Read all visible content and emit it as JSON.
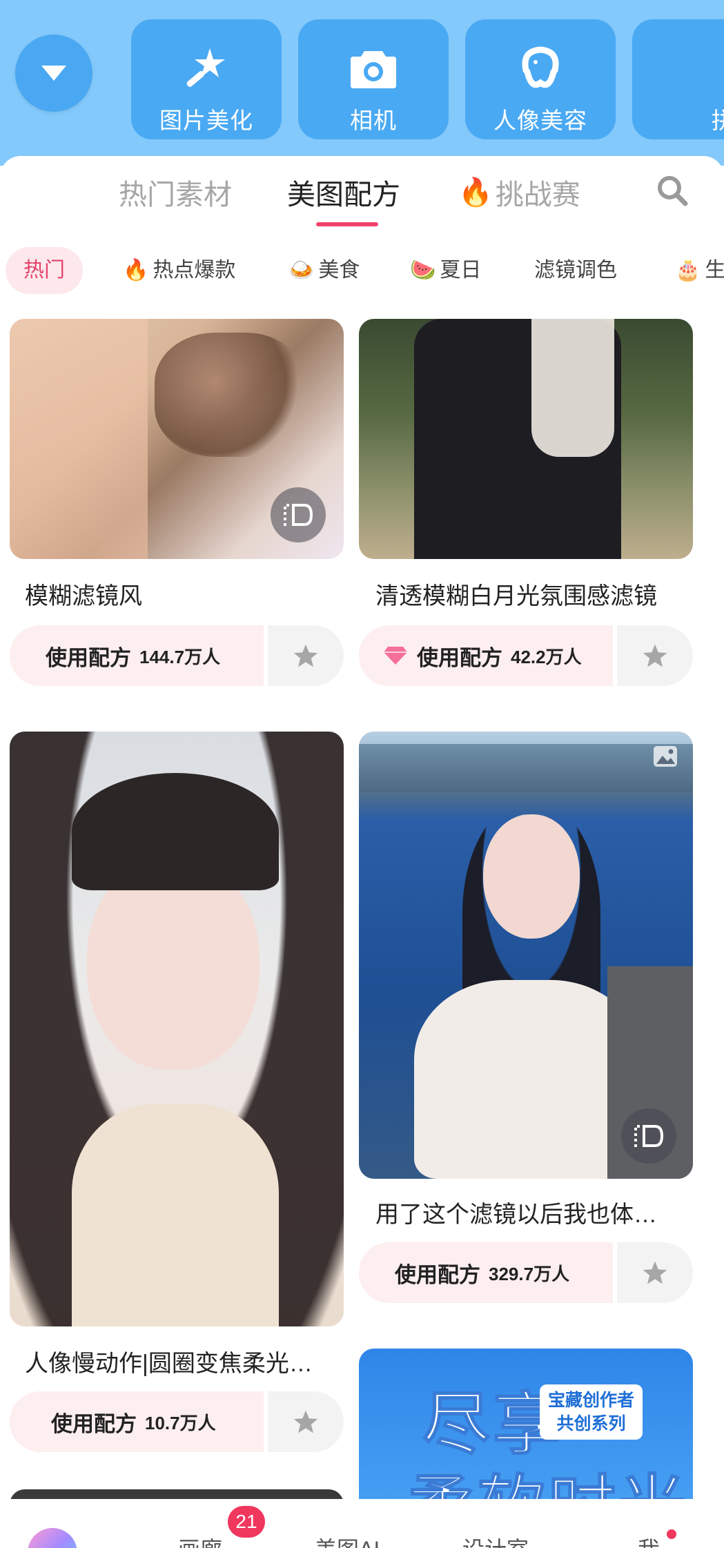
{
  "quick_tools": {
    "items": [
      {
        "label": "图片美化",
        "icon": "magic-wand-icon"
      },
      {
        "label": "相机",
        "icon": "camera-icon"
      },
      {
        "label": "人像美容",
        "icon": "face-retouch-icon"
      },
      {
        "label": "拼图",
        "icon": "collage-icon"
      }
    ]
  },
  "tabs": {
    "items": [
      {
        "label": "热门素材"
      },
      {
        "label": "美图配方"
      },
      {
        "label": "挑战赛"
      }
    ],
    "active": "美图配方"
  },
  "chips": {
    "items": [
      {
        "label": "热门",
        "emoji": ""
      },
      {
        "label": "热点爆款",
        "emoji": "🔥"
      },
      {
        "label": "美食",
        "emoji": "🍛"
      },
      {
        "label": "夏日",
        "emoji": "🍉"
      },
      {
        "label": "滤镜调色",
        "emoji": ""
      },
      {
        "label": "生",
        "emoji": "🎂"
      }
    ],
    "active": "热门"
  },
  "cards": [
    {
      "title": "模糊滤镜风",
      "use_label": "使用配方",
      "count": "144.7万人",
      "has_live_badge": true
    },
    {
      "title": "清透模糊白月光氛围感滤镜",
      "use_label": "使用配方",
      "count": "42.2万人",
      "has_gem": true
    },
    {
      "title": "人像慢动作|圆圈变焦柔光…",
      "use_label": "使用配方",
      "count": "10.7万人"
    },
    {
      "title": "用了这个滤镜以后我也体…",
      "use_label": "使用配方",
      "count": "329.7万人",
      "has_live_badge": true,
      "has_image_badge": true
    },
    {
      "promo_tag_line1": "宝藏创作者",
      "promo_tag_line2": "共创系列",
      "promo_text1": "尽享",
      "promo_text2": "柔软时光"
    }
  ],
  "bottom_nav": {
    "items": [
      {
        "label": "画廊"
      },
      {
        "label": "美图AI"
      },
      {
        "label": "设计室"
      },
      {
        "label": "我"
      }
    ],
    "badge_count": "21"
  },
  "colors": {
    "top_bar_bg": "#83c9fb",
    "tool_tile": "#4aa9f3",
    "accent_pink": "#f0416c",
    "chip_active_bg": "#fde8ec",
    "use_button_bg": "#fdeef0"
  }
}
